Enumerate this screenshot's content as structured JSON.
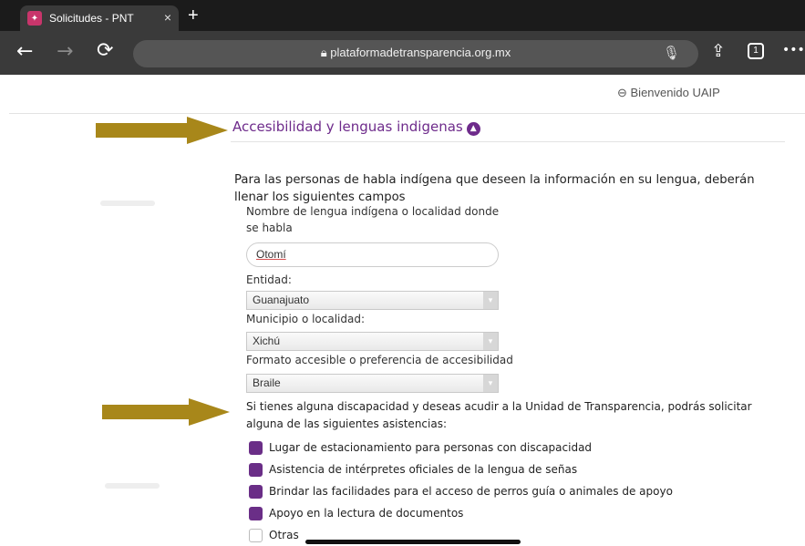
{
  "browser": {
    "tab_title": "Solicitudes - PNT",
    "tab_close": "×",
    "new_tab": "+",
    "url": "plataformadetransparencia.org.mx",
    "tab_count": "1",
    "more": "•••"
  },
  "header": {
    "welcome": "Bienvenido UAIP"
  },
  "section": {
    "title": "Accesibilidad y lenguas indigenas",
    "intro": "Para las personas de habla indígena que deseen la información en su lengua, deberán llenar los siguientes campos"
  },
  "form": {
    "language_label": "Nombre de lengua indígena o localidad donde se habla",
    "language_value": "Otomí",
    "entity_label": "Entidad:",
    "entity_value": "Guanajuato",
    "municipality_label": "Municipio o localidad:",
    "municipality_value": "Xichú",
    "format_label": "Formato accesible o preferencia de accesibilidad",
    "format_value": "Braile"
  },
  "assistance": {
    "text": "Si tienes alguna discapacidad y deseas acudir a la Unidad de Transparencia, podrás solicitar alguna de las siguientes asistencias:",
    "options": [
      {
        "label": "Lugar de estacionamiento para personas con discapacidad",
        "checked": true
      },
      {
        "label": "Asistencia de intérpretes oficiales de la lengua de señas",
        "checked": true
      },
      {
        "label": "Brindar las facilidades para el acceso de perros guía o animales de apoyo",
        "checked": true
      },
      {
        "label": "Apoyo en la lectura de documentos",
        "checked": true
      },
      {
        "label": "Otras",
        "checked": false
      }
    ]
  },
  "colors": {
    "accent": "#6e2b8b",
    "checkbox": "#6a2e87",
    "arrow": "#a8871a"
  }
}
